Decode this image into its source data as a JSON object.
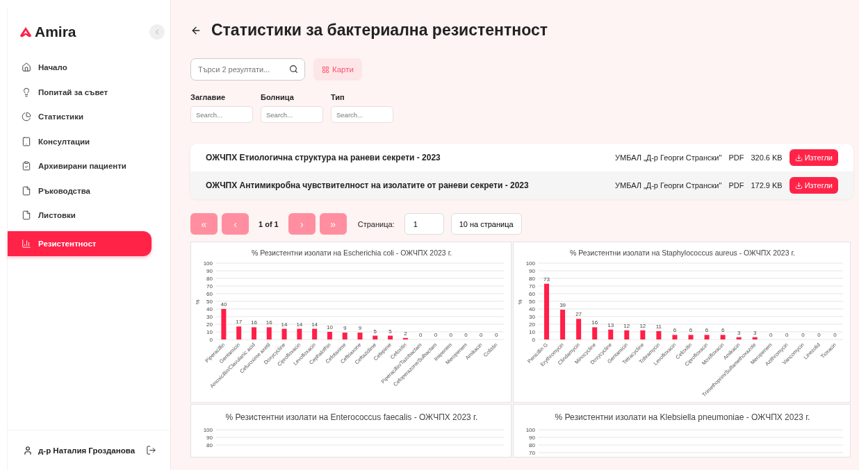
{
  "sidebar": {
    "logo": "Amira",
    "items": [
      {
        "label": "Начало",
        "selected": false
      },
      {
        "label": "Попитай за съвет",
        "selected": false
      },
      {
        "label": "Статистики",
        "selected": false
      },
      {
        "label": "Консултации",
        "selected": false
      },
      {
        "label": "Архивирани пациенти",
        "selected": false
      },
      {
        "label": "Ръководства",
        "selected": false
      },
      {
        "label": "Листовки",
        "selected": false
      },
      {
        "label": "Резистентност",
        "selected": true
      }
    ],
    "user": "д-р Наталия Грозданова"
  },
  "header": {
    "title": "Статистики за бактериална резистентност"
  },
  "search": {
    "placeholder": "Търси 2 резултати..."
  },
  "view_button": "Карти",
  "filters": [
    {
      "label": "Заглавие",
      "placeholder": "Search..."
    },
    {
      "label": "Болница",
      "placeholder": "Search..."
    },
    {
      "label": "Тип",
      "placeholder": "Search..."
    }
  ],
  "documents": [
    {
      "title": "ОЖЧПХ Етиологична структура на раневи секрети - 2023",
      "hospital": "УМБАЛ „Д-р Георги Странски\"",
      "type": "PDF",
      "size": "320.6 KB",
      "action": "Изтегли"
    },
    {
      "title": "ОЖЧПХ Антимикробна чувствителност на изолатите от раневи секрети - 2023",
      "hospital": "УМБАЛ „Д-р Георги Странски\"",
      "type": "PDF",
      "size": "172.9 KB",
      "action": "Изтегли"
    }
  ],
  "pagination": {
    "first": "«",
    "prev": "‹",
    "info": "1 of 1",
    "next": "›",
    "last": "»",
    "page_label": "Страница:",
    "page_value": "1",
    "per_page": "10 на страница"
  },
  "charts": [
    {
      "chart_data": {
        "type": "bar",
        "title": "% Резистентни изолати на Escherichia coli - ОЖЧПХ 2023 г.",
        "ylabel": "%",
        "ylim": [
          0,
          100
        ],
        "yticks": [
          0,
          10,
          20,
          30,
          40,
          50,
          60,
          70,
          80,
          90,
          100
        ],
        "grid": true,
        "data_labels": true,
        "categories": [
          "Piperacillin",
          "Gentamicin",
          "Amoxicillin/Clavulanic acid",
          "Cefuroxime axetil",
          "Doxycycline",
          "Ciprofloxacin",
          "Levofloxacin",
          "Cephalothin",
          "Cefotaxime",
          "Ceftriaxone",
          "Ceftazidime",
          "Cefepime",
          "Cefoxitin",
          "Piperacillin/Tazobactam",
          "Cefoperazone/Sulbactam",
          "Imipenem",
          "Meropenem",
          "Amikacin",
          "Colistin"
        ],
        "series": [
          {
            "color": "#ff1f48",
            "values": [
              40,
              17,
              16,
              16,
              14,
              14,
              14,
              10,
              9,
              9,
              5,
              5,
              2,
              0,
              0,
              0,
              0,
              0,
              0
            ]
          }
        ]
      }
    },
    {
      "chart_data": {
        "type": "bar",
        "title": "% Резистентни изолати на Staphylococcus aureus - ОЖЧПХ 2023 г.",
        "ylabel": "%",
        "ylim": [
          0,
          100
        ],
        "yticks": [
          0,
          10,
          20,
          30,
          40,
          50,
          60,
          70,
          80,
          90,
          100
        ],
        "grid": true,
        "data_labels": true,
        "categories": [
          "Penicillin G",
          "Erythromycin",
          "Clindamycin",
          "Minocycline",
          "Doxycycline",
          "Gentamicin",
          "Tetracycline",
          "Tobramycin",
          "Levofloxacin",
          "Cefoxitin",
          "Ciprofloxacin",
          "Moxifloxacin",
          "Amikacin",
          "Trimethoprim/Sulfamethoxazole",
          "Meropenem",
          "Azithromycin",
          "Vancomycin",
          "Linezolid",
          "Tioxacin"
        ],
        "series": [
          {
            "color": "#ff1f48",
            "values": [
              73,
              39,
              27,
              16,
              13,
              12,
              12,
              11,
              6,
              6,
              6,
              6,
              3,
              3,
              0,
              0,
              0,
              0,
              0
            ]
          }
        ]
      }
    },
    {
      "title": "% Резистентни изолати на Enterococcus faecalis - ОЖЧПХ 2023 г.",
      "axis_labels": [
        "100",
        "90",
        "80"
      ]
    },
    {
      "title": "% Резистентни изолати на Klebsiella pneumoniae - ОЖЧПХ 2023 г.",
      "axis_labels": [
        "100",
        "90",
        "80",
        "70"
      ]
    }
  ]
}
